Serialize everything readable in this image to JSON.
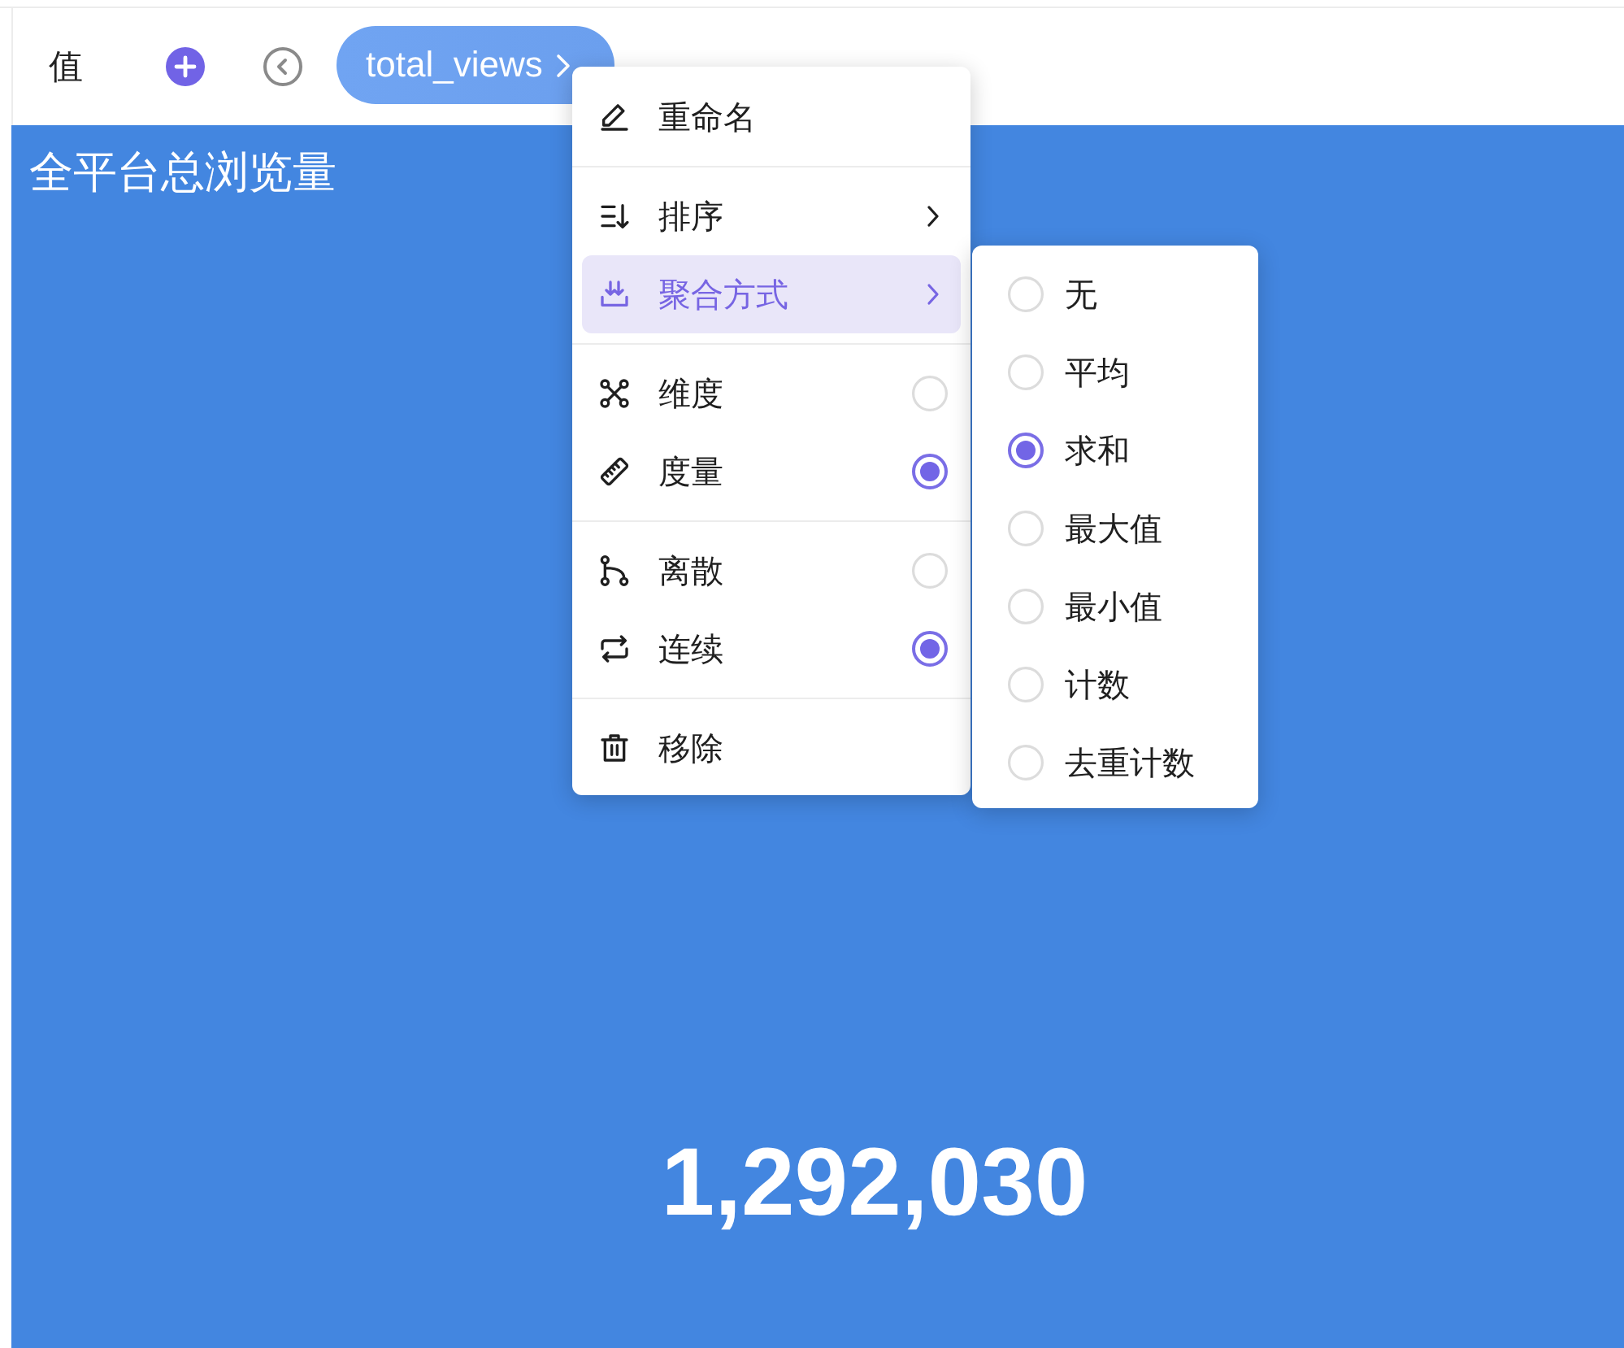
{
  "toolbar": {
    "label": "值",
    "field_pill": {
      "label": "total_views"
    }
  },
  "card": {
    "title": "全平台总浏览量",
    "value": "1,292,030"
  },
  "context_menu": {
    "groups": [
      [
        {
          "label": "重命名",
          "kind": "action"
        }
      ],
      [
        {
          "label": "排序",
          "kind": "submenu",
          "expanded": false
        },
        {
          "label": "聚合方式",
          "kind": "submenu",
          "expanded": true
        }
      ],
      [
        {
          "label": "维度",
          "kind": "option",
          "selected": false
        },
        {
          "label": "度量",
          "kind": "option",
          "selected": true
        }
      ],
      [
        {
          "label": "离散",
          "kind": "option",
          "selected": false
        },
        {
          "label": "连续",
          "kind": "option",
          "selected": true
        }
      ],
      [
        {
          "label": "移除",
          "kind": "action"
        }
      ]
    ]
  },
  "submenu": {
    "options": [
      {
        "label": "无",
        "selected": false
      },
      {
        "label": "平均",
        "selected": false
      },
      {
        "label": "求和",
        "selected": true
      },
      {
        "label": "最大值",
        "selected": false
      },
      {
        "label": "最小值",
        "selected": false
      },
      {
        "label": "计数",
        "selected": false
      },
      {
        "label": "去重计数",
        "selected": false
      }
    ]
  }
}
